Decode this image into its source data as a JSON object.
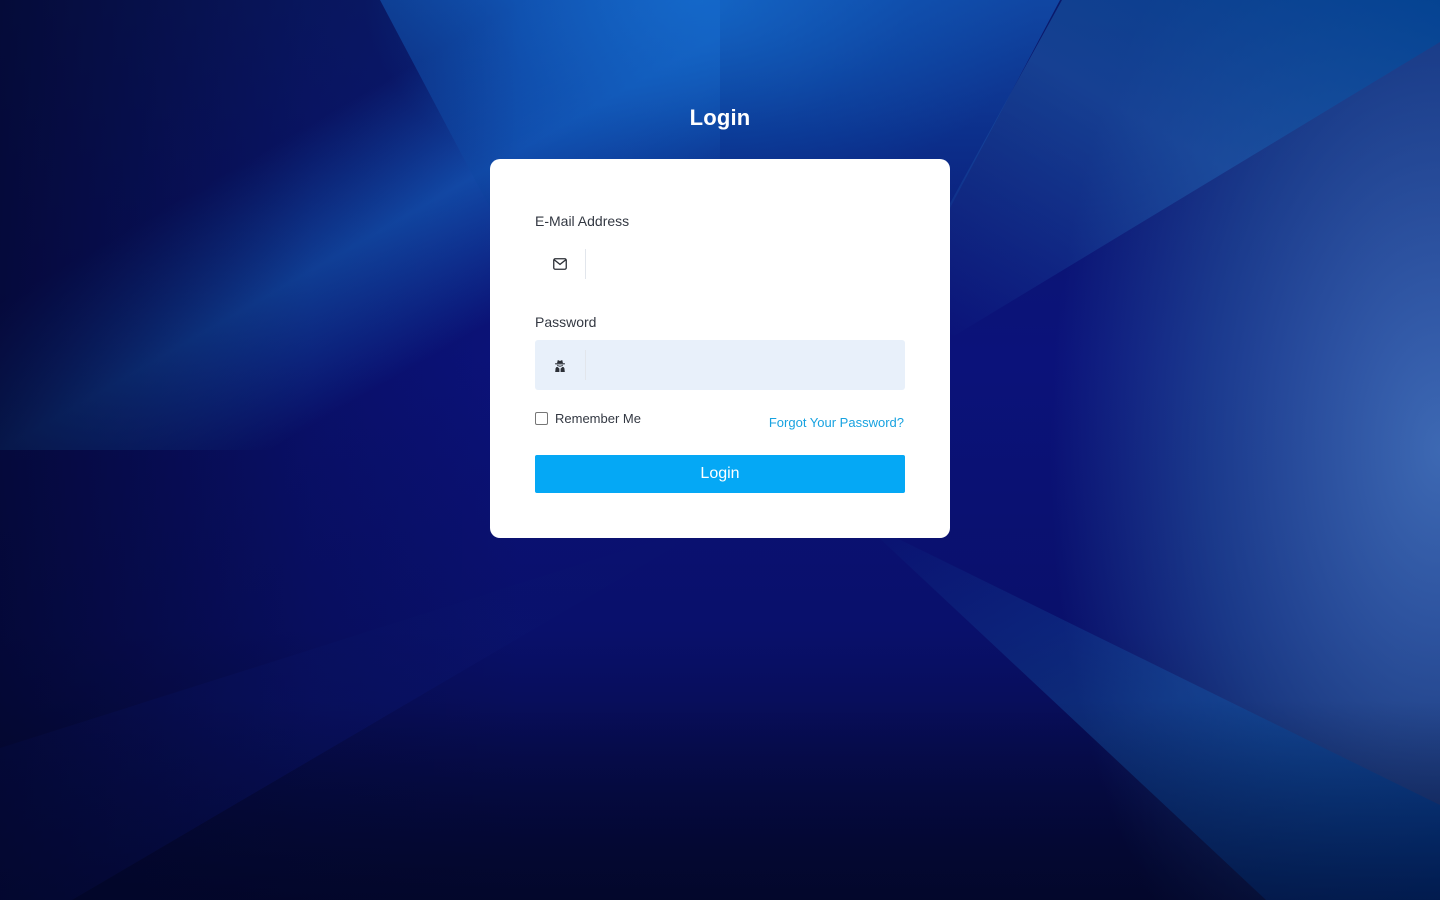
{
  "page": {
    "title": "Login"
  },
  "form": {
    "email": {
      "label": "E-Mail Address",
      "value": "",
      "icon": "envelope-icon"
    },
    "password": {
      "label": "Password",
      "value": "",
      "icon": "user-secret-icon"
    },
    "remember": {
      "label": "Remember Me",
      "checked": false
    },
    "forgot_link": "Forgot Your Password?",
    "submit_label": "Login"
  },
  "colors": {
    "primary_button": "#05a8f5",
    "link": "#17a2e0",
    "password_field_bg": "#e8f0fa",
    "card_bg": "#ffffff",
    "title_text": "#ffffff"
  }
}
